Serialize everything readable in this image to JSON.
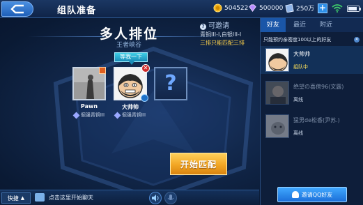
{
  "header": {
    "title": "组队准备",
    "gold": "504522",
    "diamonds": "500000",
    "vouchers": "250万",
    "add_label": "+"
  },
  "battery_level": 0.85,
  "mode": {
    "title": "多人排位",
    "map": "王者峡谷"
  },
  "invite_info": {
    "heading": "可邀请",
    "line1": "青铜III-I,白银III-I",
    "line2": "三排只能匹配三排"
  },
  "wait_tag": "等我一下",
  "slots": [
    {
      "name": "Pawn",
      "rank": "倔强青铜III"
    },
    {
      "name": "大帅帅",
      "rank": "倔强青铜III"
    },
    {
      "empty_label": "?"
    }
  ],
  "start_button": "开始匹配",
  "chat": {
    "quick_label": "快捷",
    "placeholder": "点击这里开始聊天"
  },
  "panel": {
    "tabs": [
      "好友",
      "最近",
      "附近"
    ],
    "notice": "只能预约亲密度100以上的好友",
    "friends": [
      {
        "name": "大帅帅",
        "status": "组队中"
      },
      {
        "name": "绝望の喜傍96(文露)",
        "status": "离线"
      },
      {
        "name": "猛男de松香(尹苏.)",
        "status": "离线"
      }
    ],
    "invite_qq": "邀请QQ好友"
  }
}
